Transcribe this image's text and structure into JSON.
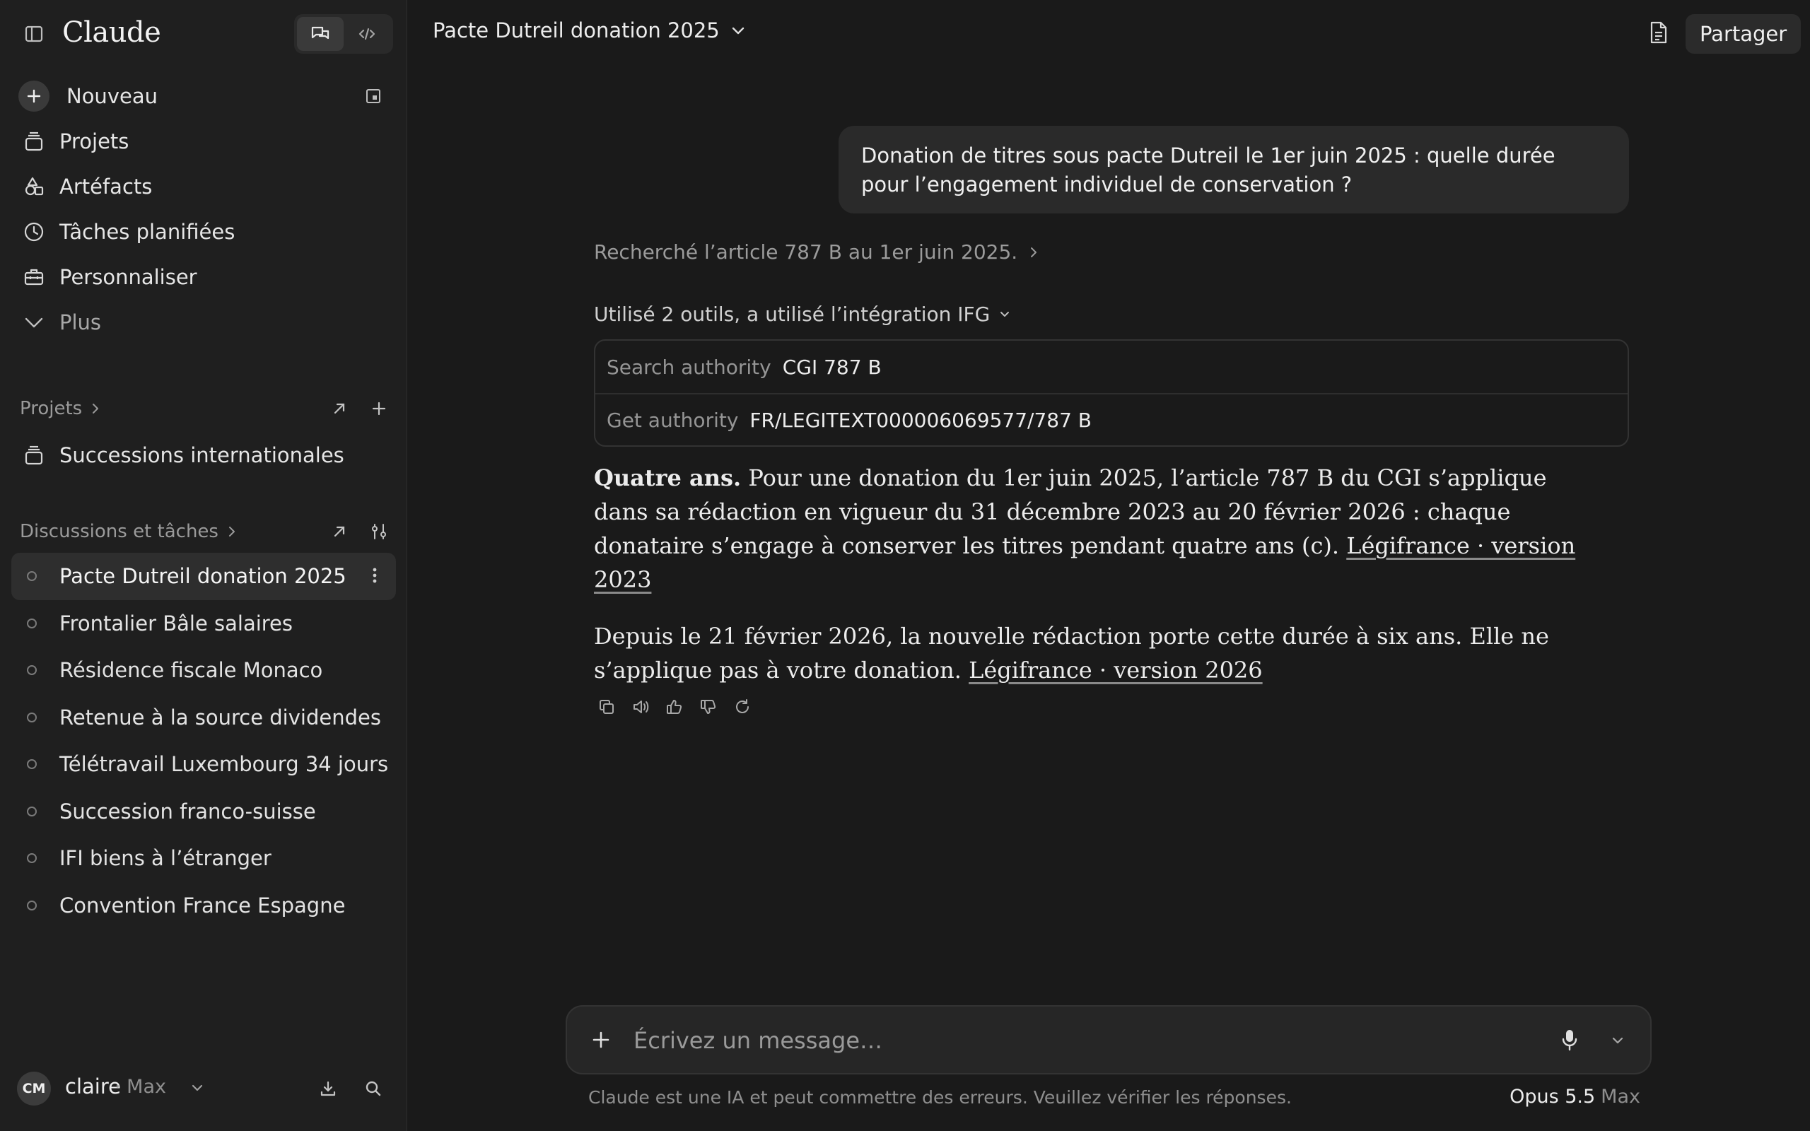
{
  "sidebar": {
    "logo": "Claude",
    "nav": [
      {
        "label": "Nouveau",
        "icon": "plus-icon"
      },
      {
        "label": "Projets",
        "icon": "stack-icon"
      },
      {
        "label": "Artéfacts",
        "icon": "shapes-icon"
      },
      {
        "label": "Tâches planifiées",
        "icon": "clock-icon"
      },
      {
        "label": "Personnaliser",
        "icon": "toolbox-icon"
      },
      {
        "label": "Plus",
        "icon": "chevron-down-icon"
      }
    ],
    "projects_heading": "Projets",
    "projects": [
      {
        "label": "Successions internationales"
      }
    ],
    "chats_heading": "Discussions et tâches",
    "chats": [
      {
        "label": "Pacte Dutreil donation 2025",
        "active": true
      },
      {
        "label": "Frontalier Bâle salaires"
      },
      {
        "label": "Résidence fiscale Monaco"
      },
      {
        "label": "Retenue à la source dividendes"
      },
      {
        "label": "Télétravail Luxembourg 34 jours"
      },
      {
        "label": "Succession franco-suisse"
      },
      {
        "label": "IFI biens à l’étranger"
      },
      {
        "label": "Convention France Espagne"
      }
    ],
    "user": {
      "initials": "CM",
      "name": "claire",
      "plan": "· Max"
    }
  },
  "header": {
    "chat_title": "Pacte Dutreil donation 2025",
    "share_label": "Partager"
  },
  "conversation": {
    "user_message": "Donation de titres sous pacte Dutreil le 1er juin 2025 : quelle durée pour l’engagement individuel de conservation ?",
    "thought_summary": "Recherché l’article 787 B au 1er juin 2025.",
    "tools_summary": "Utilisé 2 outils, a utilisé l’intégration IFG",
    "tools": [
      {
        "name": "Search authority",
        "arg": "CGI 787 B"
      },
      {
        "name": "Get authority",
        "arg": "FR/LEGITEXT000006069577/787 B"
      }
    ],
    "answer": {
      "p1_bold": "Quatre ans.",
      "p1_text": " Pour une donation du 1er juin 2025, l’article 787 B du CGI s’applique dans sa rédaction en vigueur du 31 décembre 2023 au 20 février 2026 : chaque donataire s’engage à conserver les titres pendant quatre ans (c). ",
      "p1_link": "Légifrance · version 2023",
      "p2_text": "Depuis le 21 février 2026, la nouvelle rédaction porte cette durée à six ans. Elle ne s’applique pas à votre donation. ",
      "p2_link": "Légifrance · version 2026"
    }
  },
  "composer": {
    "placeholder": "Écrivez un message…",
    "disclaimer": "Claude est une IA et peut commettre des erreurs. Veuillez vérifier les réponses.",
    "model": "Opus 5.5",
    "model_tier": "Max"
  }
}
